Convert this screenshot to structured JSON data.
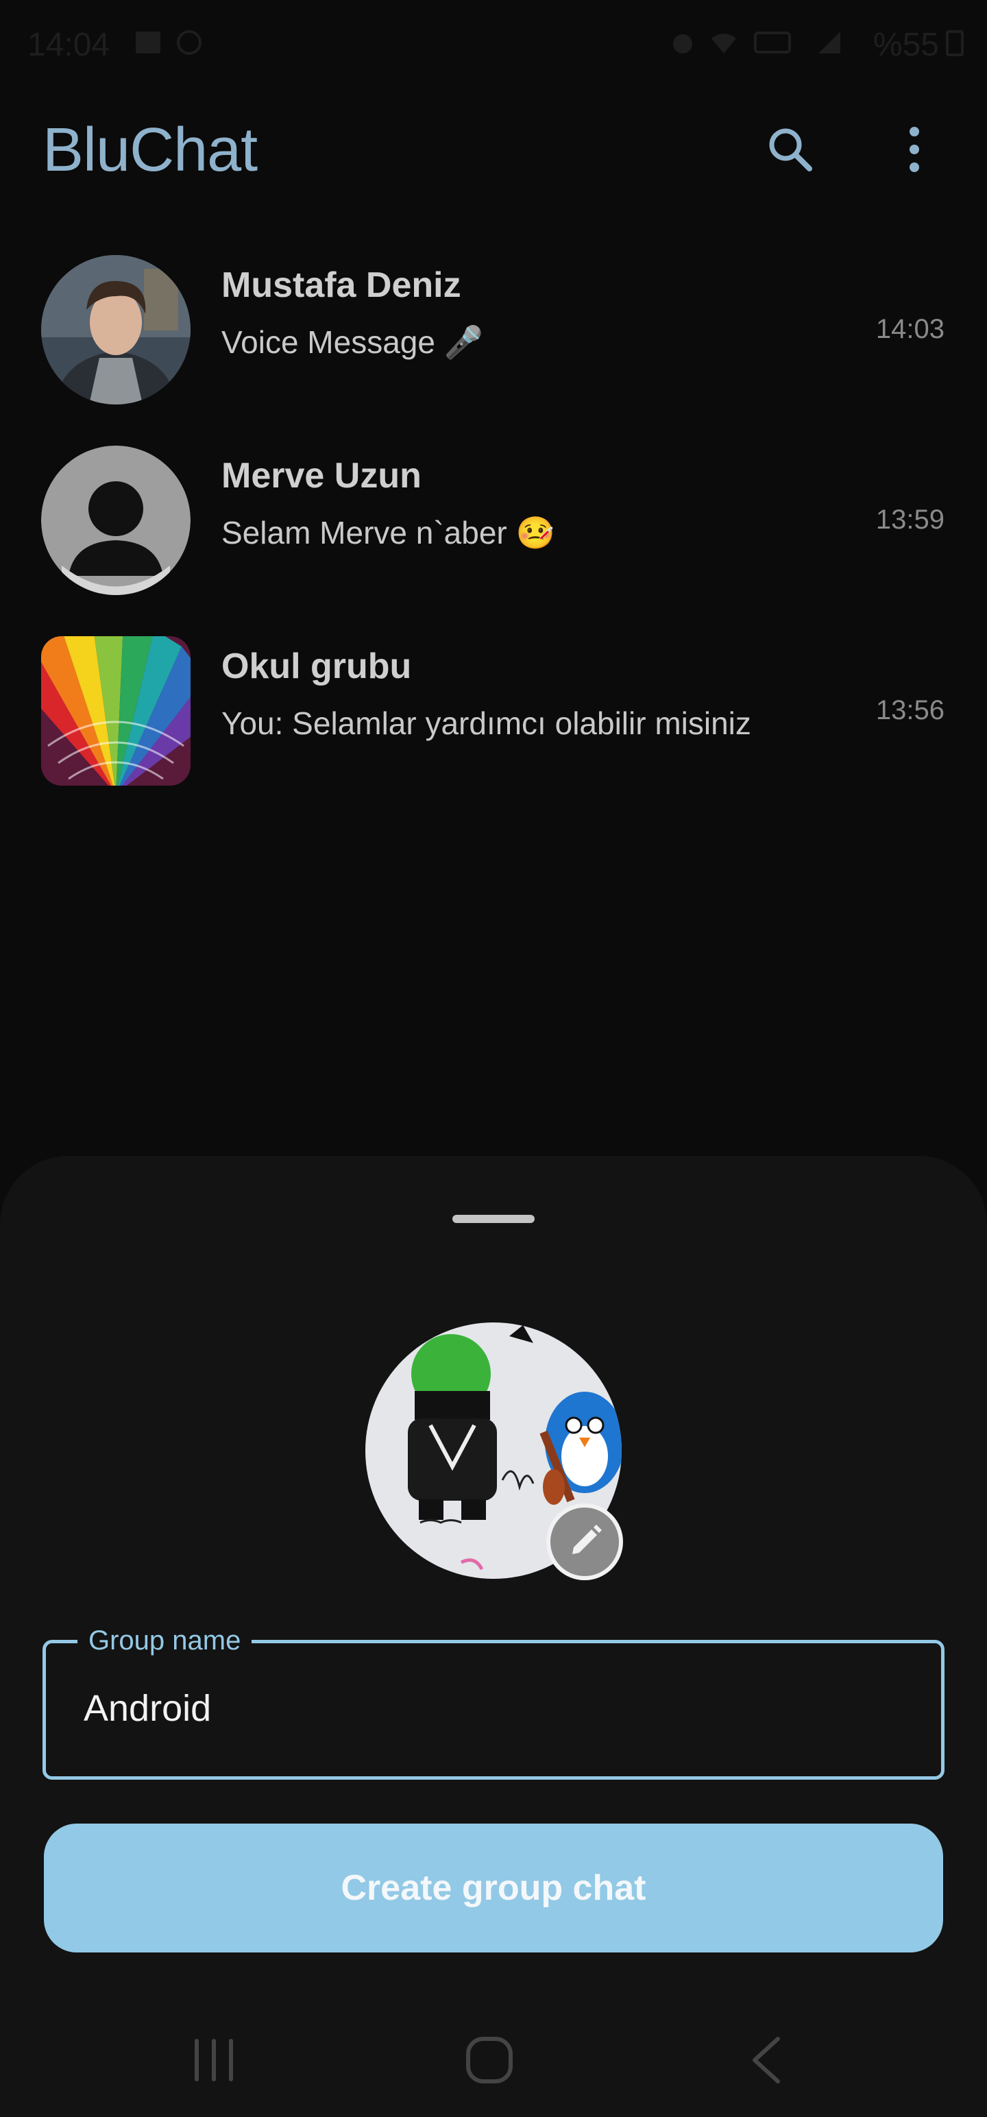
{
  "status_bar": {
    "time": "14:04",
    "battery": "%55",
    "icons": [
      "gallery-icon",
      "whatsapp-icon",
      "alarm-icon",
      "wifi-icon",
      "hd-icon",
      "signal-icon",
      "battery-icon"
    ]
  },
  "app_bar": {
    "title": "BluChat",
    "actions": [
      "search-icon",
      "more-vert-icon"
    ]
  },
  "chats": [
    {
      "name": "Mustafa Deniz",
      "message": "Voice Message 🎤",
      "time": "14:03",
      "avatar": "photo-avatar"
    },
    {
      "name": "Merve Uzun",
      "message": "Selam Merve n`aber 🤒",
      "time": "13:59",
      "avatar": "default-person-avatar"
    },
    {
      "name": "Okul grubu",
      "message": "You: Selamlar yardımcı olabilir misiniz",
      "time": "13:56",
      "avatar": "color-swatch-avatar"
    }
  ],
  "sheet": {
    "field_label": "Group name",
    "field_value": "Android",
    "create_button": "Create group chat"
  },
  "nav_bar": {
    "items": [
      "recent-apps-icon",
      "home-icon",
      "back-icon"
    ]
  },
  "colors": {
    "accent": "#94c9e6",
    "title": "#8fb2cc",
    "background": "#0b0b0b",
    "sheet": "#131313"
  }
}
